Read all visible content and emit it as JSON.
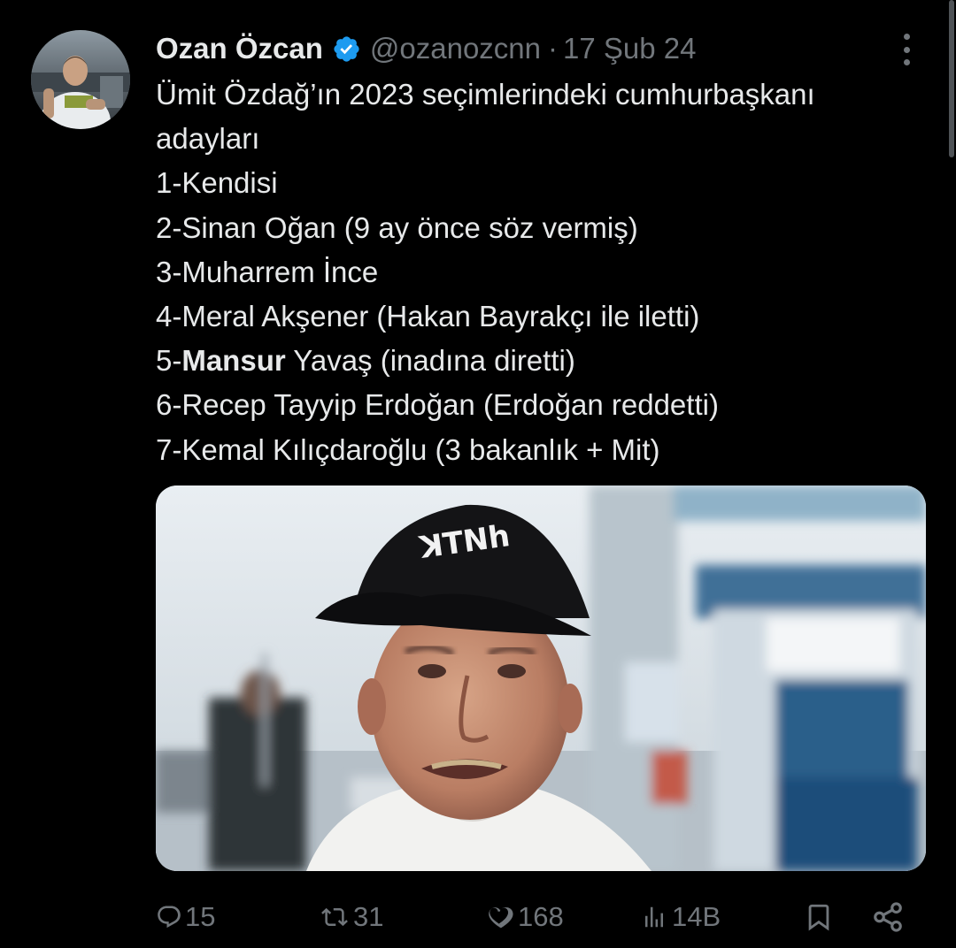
{
  "tweet": {
    "author": {
      "name": "Ozan Özcan",
      "handle": "@ozanozcnn",
      "verified": true
    },
    "separator": "·",
    "date": "17 Şub 24",
    "text": {
      "line1": "Ümit Özdağ’ın 2023 seçimlerindeki cumhurbaşkanı",
      "line2": "adayları",
      "line3": "1-Kendisi",
      "line4": "2-Sinan Oğan (9 ay önce söz vermiş)",
      "line5": "3-Muharrem İnce",
      "line6": "4-Meral Akşener (Hakan Bayrakçı ile iletti)",
      "line7_prefix": "5-",
      "line7_bold": "Mansur",
      "line7_rest": " Yavaş (inadına diretti)",
      "line8": "6-Recep Tayyip Erdoğan (Erdoğan reddetti)",
      "line9": "7-Kemal Kılıçdaroğlu (3 bakanlık + Mit)"
    },
    "media": {
      "cap_text": "ꓘTNh"
    },
    "stats": {
      "replies": "15",
      "reposts": "31",
      "likes": "168",
      "views": "14B"
    }
  },
  "icons": {
    "verified": "verified-badge-icon",
    "more": "more-dots-icon",
    "reply": "reply-icon",
    "repost": "repost-icon",
    "like": "heart-icon",
    "views": "views-chart-icon",
    "bookmark": "bookmark-icon",
    "share": "share-icon"
  },
  "colors": {
    "background": "#000000",
    "text": "#e7e9ea",
    "secondary": "#71767b",
    "verified": "#1d9bf0"
  }
}
